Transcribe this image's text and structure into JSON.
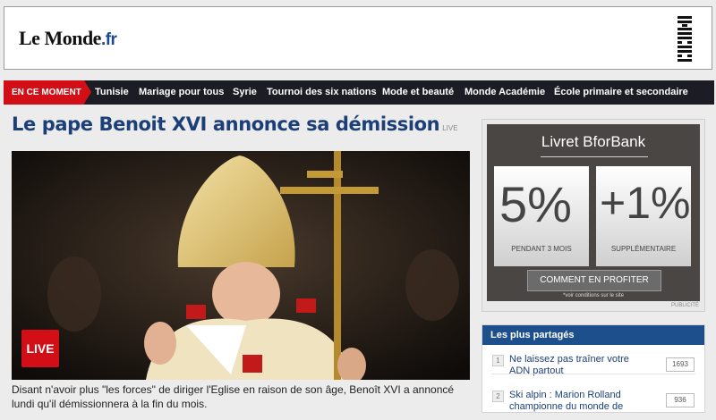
{
  "header": {
    "logo": "Le Monde",
    "logo_suffix": ".fr",
    "sponsor": "IBM"
  },
  "nav": {
    "highlight": "EN CE MOMENT",
    "links": [
      "Tunisie",
      "Mariage pour tous",
      "Syrie",
      "Tournoi des six nations",
      "Mode et beauté",
      "Monde Académie",
      "École primaire et secondaire"
    ]
  },
  "article": {
    "headline": "Le pape Benoit XVI annonce sa démission",
    "live_tag": "LIVE",
    "badge": "LIVE",
    "caption": "Disant n'avoir plus \"les forces\" de diriger l'Eglise en raison de son âge, Benoît XVI a annoncé lundi qu'il démissionnera à la fin du mois."
  },
  "ad": {
    "title": "Livret BforBank",
    "card1_big": "5%",
    "card1_sub": "PENDANT 3 MOIS",
    "card2_big": "+1%",
    "card2_sub": "SUPPLÉMENTAIRE",
    "cta": "COMMENT EN PROFITER",
    "note": "*voir conditions sur le site",
    "label": "PUBLICITÉ"
  },
  "most_shared": {
    "title": "Les plus partagés",
    "items": [
      {
        "rank": "1",
        "text": "Ne laissez pas traîner votre ADN partout",
        "count": "1693"
      },
      {
        "rank": "2",
        "text": "Ski alpin : Marion Rolland championne du monde de",
        "count": "936"
      }
    ]
  },
  "colors": {
    "nav_bg": "#1c1c24",
    "accent_red": "#d20f17",
    "headline_blue": "#1c3f78",
    "box_blue": "#1c4f8c"
  }
}
